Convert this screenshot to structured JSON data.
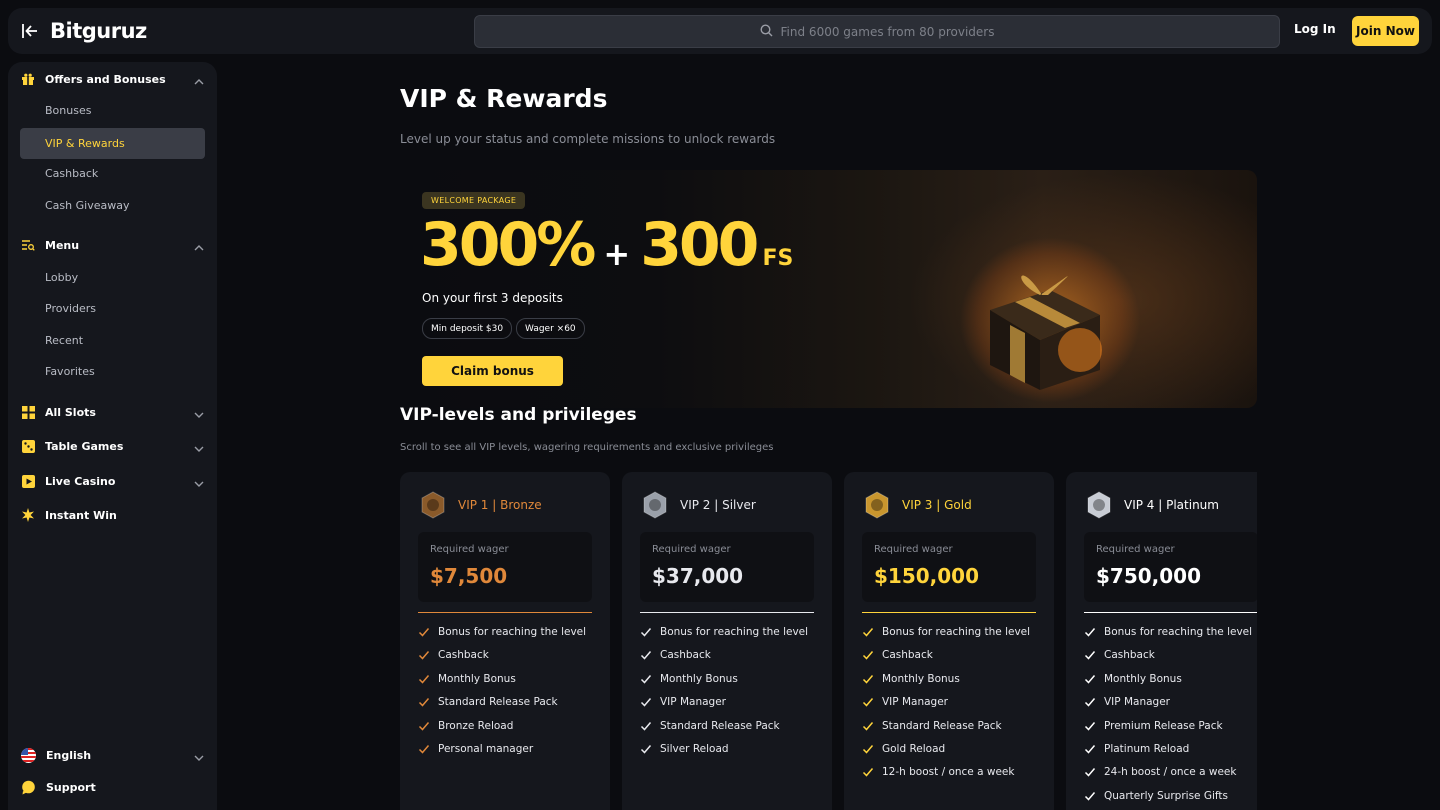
{
  "header": {
    "logo_text": "Bitguruz",
    "search_placeholder": "Find 6000 games from 80 providers",
    "login_label": "Log In",
    "join_label": "Join Now"
  },
  "sidebar": {
    "offers": {
      "label": "Offers and Bonuses",
      "items": [
        "Bonuses",
        "VIP & Rewards",
        "Cashback",
        "Cash Giveaway"
      ],
      "active": "VIP & Rewards"
    },
    "menu": {
      "label": "Menu",
      "items": [
        "Lobby",
        "Providers",
        "Recent",
        "Favorites"
      ]
    },
    "categories": [
      "All Slots",
      "Table Games",
      "Live Casino",
      "Instant Win"
    ],
    "language": "English",
    "support": "Support"
  },
  "page": {
    "title": "VIP & Rewards",
    "subtitle": "Level up your status and complete missions to unlock rewards"
  },
  "banner": {
    "badge": "WELCOME PACKAGE",
    "percent": "300%",
    "plus": "+",
    "spins": "300",
    "spins_unit": "FS",
    "description": "On your first 3 deposits",
    "pills": [
      "Min deposit $30",
      "Wager ×60"
    ],
    "cta": "Claim bonus"
  },
  "vip": {
    "title": "VIP-levels and privileges",
    "subtitle": "Scroll to see all VIP levels, wagering requirements and exclusive privileges",
    "wager_label": "Required wager",
    "levels": [
      {
        "name": "VIP 1 | Bronze",
        "color": "#e0883a",
        "wager": "$7,500",
        "perks": [
          "Bonus for reaching the level",
          "Cashback",
          "Monthly Bonus",
          "Standard Release Pack",
          "Bronze Reload",
          "Personal manager"
        ]
      },
      {
        "name": "VIP 2 | Silver",
        "color": "#e8e9ee",
        "wager": "$37,000",
        "perks": [
          "Bonus for reaching the level",
          "Cashback",
          "Monthly Bonus",
          "VIP Manager",
          "Standard Release Pack",
          "Silver Reload"
        ]
      },
      {
        "name": "VIP 3 | Gold",
        "color": "#ffd43b",
        "wager": "$150,000",
        "perks": [
          "Bonus for reaching the level",
          "Cashback",
          "Monthly Bonus",
          "VIP Manager",
          "Standard Release Pack",
          "Gold Reload",
          "12-h boost / once a week"
        ]
      },
      {
        "name": "VIP 4 | Platinum",
        "color": "#ffffff",
        "wager": "$750,000",
        "perks": [
          "Bonus for reaching the level",
          "Cashback",
          "Monthly Bonus",
          "VIP Manager",
          "Premium Release Pack",
          "Platinum Reload",
          "24-h boost / once a week",
          "Quarterly Surprise Gifts"
        ]
      }
    ]
  },
  "colors": {
    "accent": "#ffd43b",
    "background": "#0b0c10",
    "panel": "#15171d"
  }
}
